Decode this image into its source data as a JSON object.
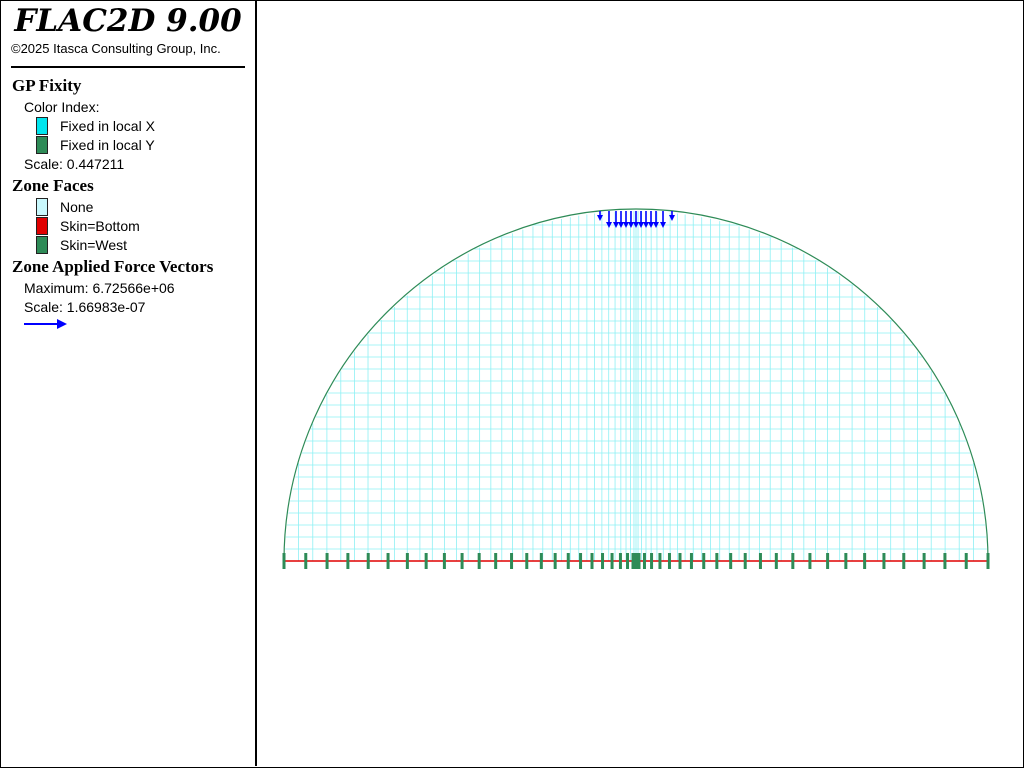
{
  "header": {
    "app_title": "FLAC2D 9.00",
    "copyright": "©2025 Itasca Consulting Group, Inc."
  },
  "legend": {
    "gp_fixity": {
      "heading": "GP Fixity",
      "color_index_label": "Color Index:",
      "items": [
        {
          "label": "Fixed in local X",
          "color": "#00e5ee"
        },
        {
          "label": "Fixed in local Y",
          "color": "#2e8b57"
        }
      ],
      "scale_text": "Scale: 0.447211"
    },
    "zone_faces": {
      "heading": "Zone Faces",
      "items": [
        {
          "label": "None",
          "color": "#c8f8fc"
        },
        {
          "label": "Skin=Bottom",
          "color": "#e00000"
        },
        {
          "label": "Skin=West",
          "color": "#2e8b57"
        }
      ]
    },
    "zone_force": {
      "heading": "Zone Applied Force Vectors",
      "maximum_text": "Maximum: 6.72566e+06",
      "scale_text": "Scale: 1.66983e-07",
      "arrow_color": "#0000ff",
      "arrow_icon": "arrow-right-icon"
    }
  },
  "model_colors": {
    "mesh": "#8ef0f4",
    "boundary": "#2e8b57",
    "bottom": "#e00000",
    "fixity": "#2e8b57",
    "force": "#0000ff"
  }
}
